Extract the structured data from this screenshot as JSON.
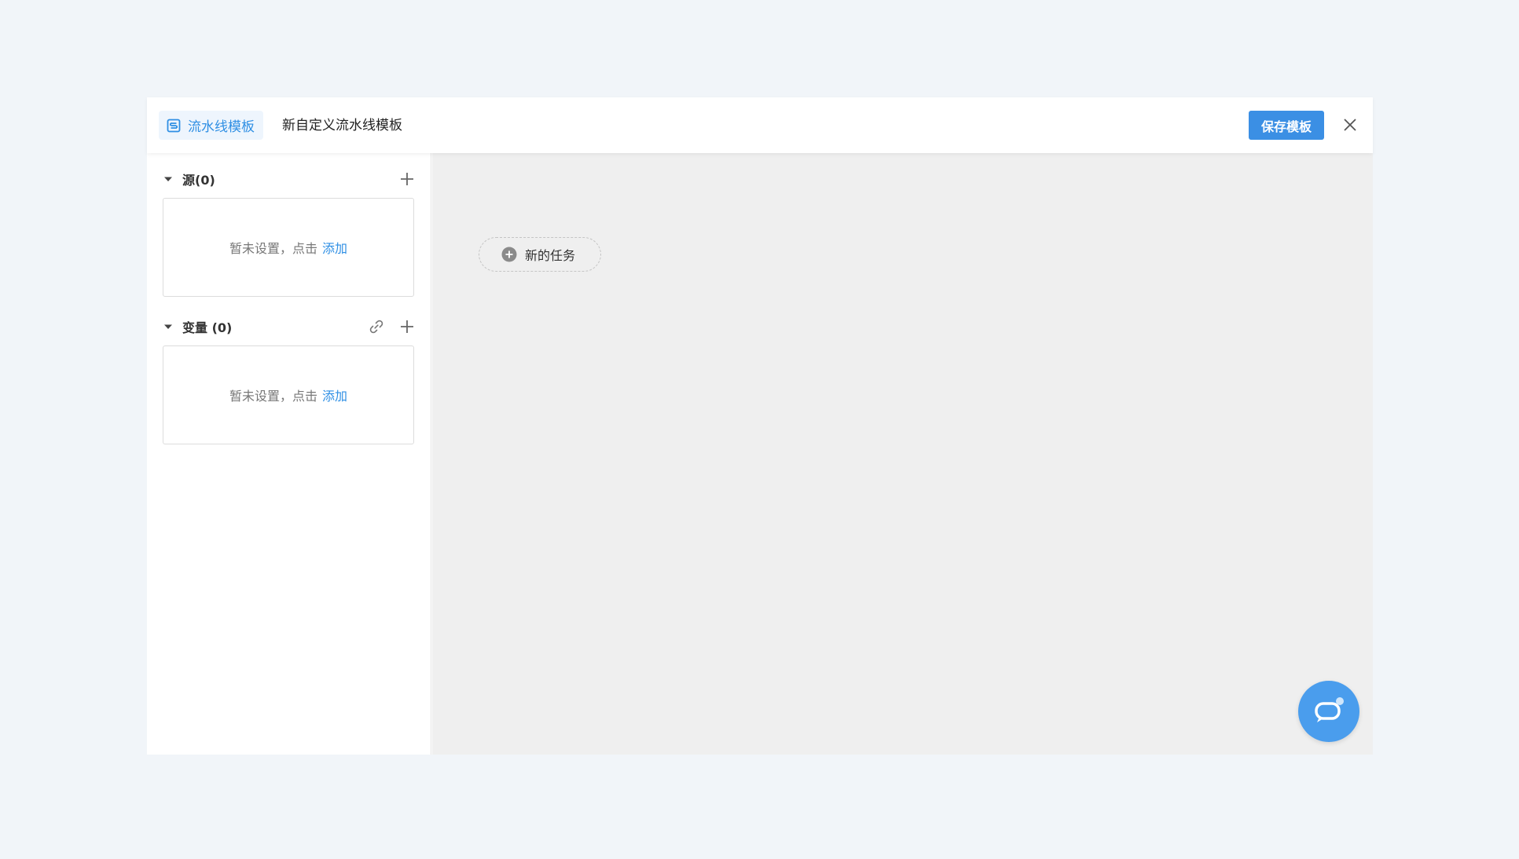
{
  "header": {
    "tag_label": "流水线模板",
    "title": "新自定义流水线模板",
    "save_label": "保存模板"
  },
  "sidebar": {
    "sources": {
      "title": "源(0)",
      "empty_text": "暂未设置，点击",
      "add_label": "添加"
    },
    "variables": {
      "title": "变量 (0)",
      "empty_text": "暂未设置，点击",
      "add_label": "添加"
    }
  },
  "canvas": {
    "new_task_label": "新的任务"
  },
  "colors": {
    "accent": "#3b8fe4",
    "page_bg": "#f1f5f9",
    "canvas_bg": "#efefef",
    "fab": "#4a9ded"
  },
  "icons": [
    "pipeline-template-icon",
    "close-icon",
    "caret-down-icon",
    "plus-icon",
    "link-icon",
    "plus-circle-icon",
    "chat-icon"
  ]
}
